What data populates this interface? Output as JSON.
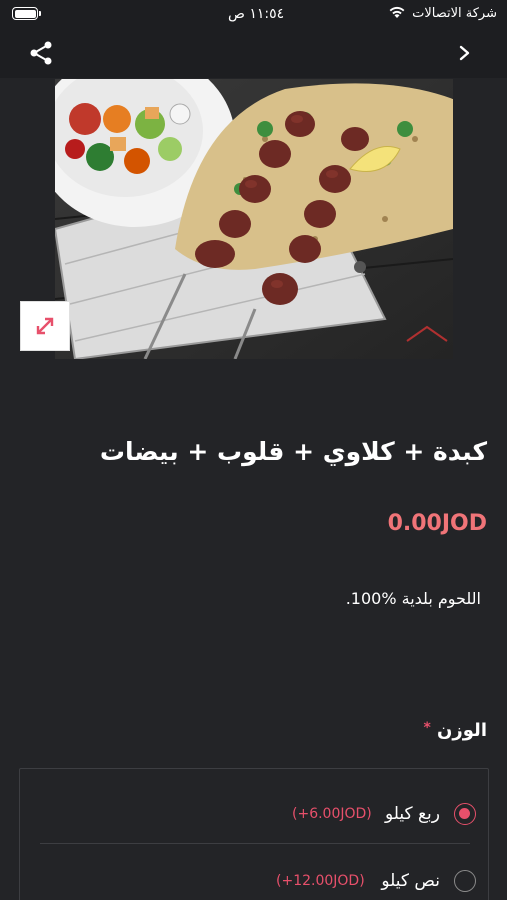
{
  "status_bar": {
    "carrier": "شركة الاتصالات",
    "time": "١١:٥٤ ص"
  },
  "product": {
    "title": "كبدة + كلاوي + قلوب + بيضات",
    "price": "0.00JOD",
    "description": "اللحوم بلدية %100."
  },
  "weight": {
    "label": "الوزن",
    "required_mark": "*",
    "options": [
      {
        "label": "ربع كيلو",
        "extra": "(+6.00JOD)",
        "selected": true
      },
      {
        "label": "نص كيلو",
        "extra": "(+12.00JOD)",
        "selected": false
      }
    ]
  },
  "colors": {
    "background": "#232427",
    "accent": "#e7506b",
    "price": "#f07478"
  }
}
